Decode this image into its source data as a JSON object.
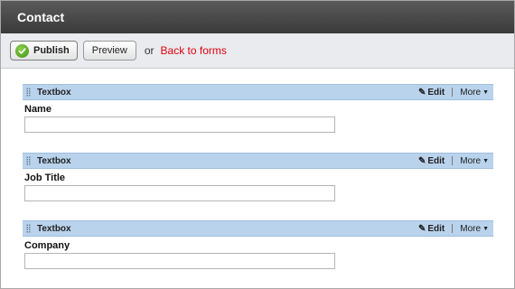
{
  "window": {
    "title": "Contact"
  },
  "toolbar": {
    "publish_label": "Publish",
    "preview_label": "Preview",
    "or_text": "or",
    "back_link": "Back to forms"
  },
  "fields": [
    {
      "type": "Textbox",
      "label": "Name",
      "edit": "Edit",
      "more": "More"
    },
    {
      "type": "Textbox",
      "label": "Job Title",
      "edit": "Edit",
      "more": "More"
    },
    {
      "type": "Textbox",
      "label": "Company",
      "edit": "Edit",
      "more": "More"
    }
  ],
  "icons": {
    "publish": "check-circle-icon",
    "edit": "pencil-icon",
    "more": "caret-down-icon",
    "grip": "drag-handle-icon"
  },
  "colors": {
    "title_bar": "#4a4a4a",
    "field_bar": "#b9d3ec",
    "link": "#e0000f",
    "publish_check": "#5bb02a"
  }
}
